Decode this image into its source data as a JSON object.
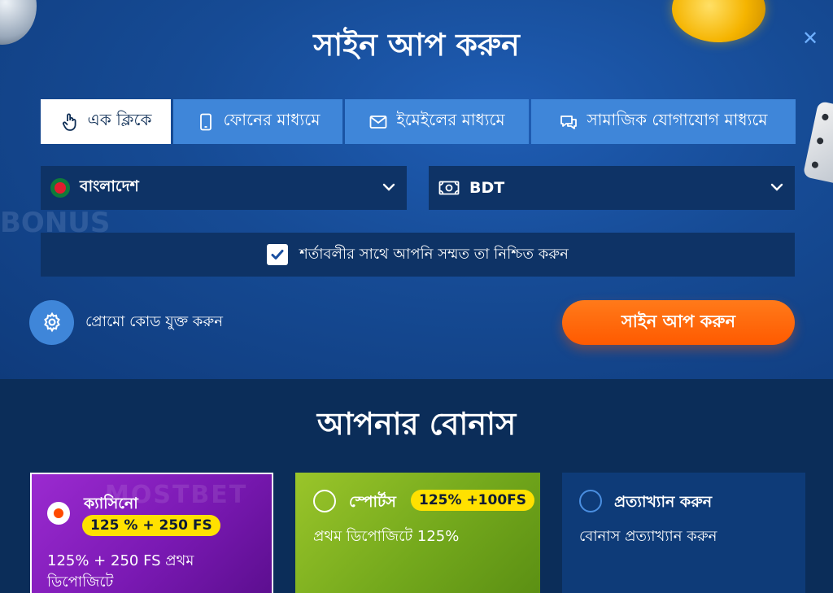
{
  "modal": {
    "title": "সাইন আপ করুন",
    "close_symbol": "✕"
  },
  "tabs": [
    {
      "label": "এক ক্লিকে",
      "icon": "hand-pointer-icon",
      "active": true
    },
    {
      "label": "ফোনের মাধ্যমে",
      "icon": "phone-icon",
      "active": false
    },
    {
      "label": "ইমেইলের মাধ্যমে",
      "icon": "envelope-icon",
      "active": false
    },
    {
      "label": "সামাজিক যোগাযোগ মাধ্যমে",
      "icon": "chat-icon",
      "active": false
    }
  ],
  "country_select": {
    "value": "বাংলাদেশ",
    "icon": "bangladesh-flag-icon"
  },
  "currency_select": {
    "value": "BDT",
    "icon": "banknote-icon"
  },
  "agree": {
    "label": "শর্তাবলীর সাথে আপনি সম্মত তা নিশ্চিত করুন",
    "checked": true
  },
  "promo": {
    "label": "প্রোমো কোড যুক্ত করুন",
    "icon": "gear-icon"
  },
  "submit_label": "সাইন আপ করুন",
  "bonus": {
    "title": "আপনার বোনাস",
    "cards": [
      {
        "name": "ক্যাসিনো",
        "badge": "125 % + 250 FS",
        "description": "125% + 250 FS প্রথম ডিপোজিটে",
        "selected": true,
        "color": "#8e22c4"
      },
      {
        "name": "স্পোর্টস",
        "badge": "125% +100FS",
        "description": "প্রথম ডিপোজিটে 125%",
        "selected": false,
        "color": "#84b824"
      },
      {
        "name": "প্রত্যাখ্যান করুন",
        "description": "বোনাস প্রত্যাখ্যান করুন",
        "selected": false,
        "color": "#0e3b78"
      }
    ]
  },
  "colors": {
    "accent_orange": "#ff5a00",
    "tab_blue": "#3f86d9",
    "field_navy": "#0e3366",
    "badge_yellow": "#ffe100"
  }
}
